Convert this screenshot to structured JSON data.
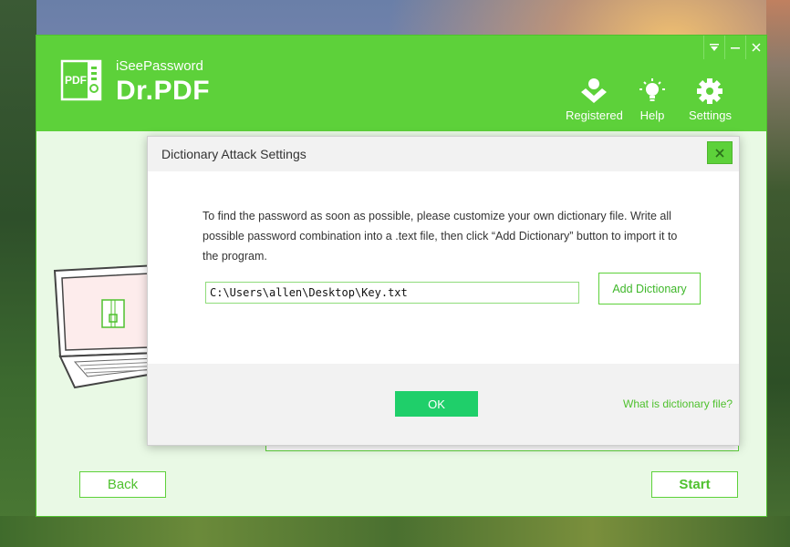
{
  "app": {
    "brand_small": "iSeePassword",
    "brand_big": "Dr.PDF",
    "logo_label": "PDF"
  },
  "nav": {
    "registered": "Registered",
    "help": "Help",
    "settings": "Settings"
  },
  "window_controls": [
    "menu-down",
    "minimize",
    "close"
  ],
  "main": {
    "back_label": "Back",
    "start_label": "Start"
  },
  "dialog": {
    "title": "Dictionary Attack Settings",
    "description": "To find the password as soon as possible, please customize your own dictionary file. Write all possible password combination into a .text file, then click “Add Dictionary” button to import it to the program.",
    "path_value": "C:\\Users\\allen\\Desktop\\Key.txt",
    "add_button_label": "Add Dictionary",
    "ok_label": "OK",
    "help_link": "What is dictionary file?"
  },
  "colors": {
    "brand_green": "#5dd13a",
    "ok_green": "#1fcf6a",
    "light_green_bg": "#e9f9e5"
  }
}
